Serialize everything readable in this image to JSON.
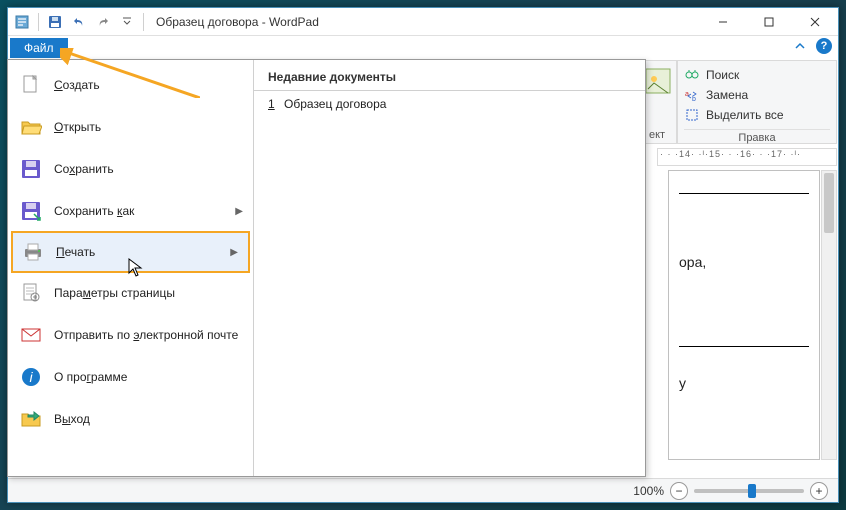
{
  "title": "Образец договора - WordPad",
  "file_tab": "Файл",
  "qat": {
    "save": "disk-icon",
    "undo": "undo-icon",
    "redo": "redo-icon"
  },
  "file_menu": {
    "items": [
      {
        "label_html": "<u>С</u>оздать",
        "icon": "new-icon"
      },
      {
        "label_html": "<u>О</u>ткрыть",
        "icon": "open-icon"
      },
      {
        "label_html": "Со<u>х</u>ранить",
        "icon": "save-icon"
      },
      {
        "label_html": "Сохранить <u>к</u>ак",
        "icon": "saveas-icon",
        "has_arrow": true
      },
      {
        "label_html": "<u>П</u>ечать",
        "icon": "print-icon",
        "has_arrow": true,
        "highlighted": true
      },
      {
        "label_html": "Пара<u>м</u>етры страницы",
        "icon": "pagesetup-icon"
      },
      {
        "label_html": "Отправить по <u>э</u>лектронной почте",
        "icon": "email-icon"
      },
      {
        "label_html": "О про<u>г</u>рамме",
        "icon": "about-icon"
      },
      {
        "label_html": "В<u>ы</u>ход",
        "icon": "exit-icon"
      }
    ],
    "recent_header": "Недавние документы",
    "recent": [
      {
        "num": "1",
        "label": "Образец договора"
      }
    ]
  },
  "editing": {
    "find": "Поиск",
    "replace": "Замена",
    "select_all": "Выделить все",
    "group_label": "Правка",
    "peek_label": "ект"
  },
  "ruler_text": "· · ·14· ·ᴵ·15· · ·16· · ·17· ·ᴵ·",
  "doc": {
    "frag1": "ора,",
    "frag2": "у"
  },
  "zoom": {
    "percent": "100%"
  }
}
